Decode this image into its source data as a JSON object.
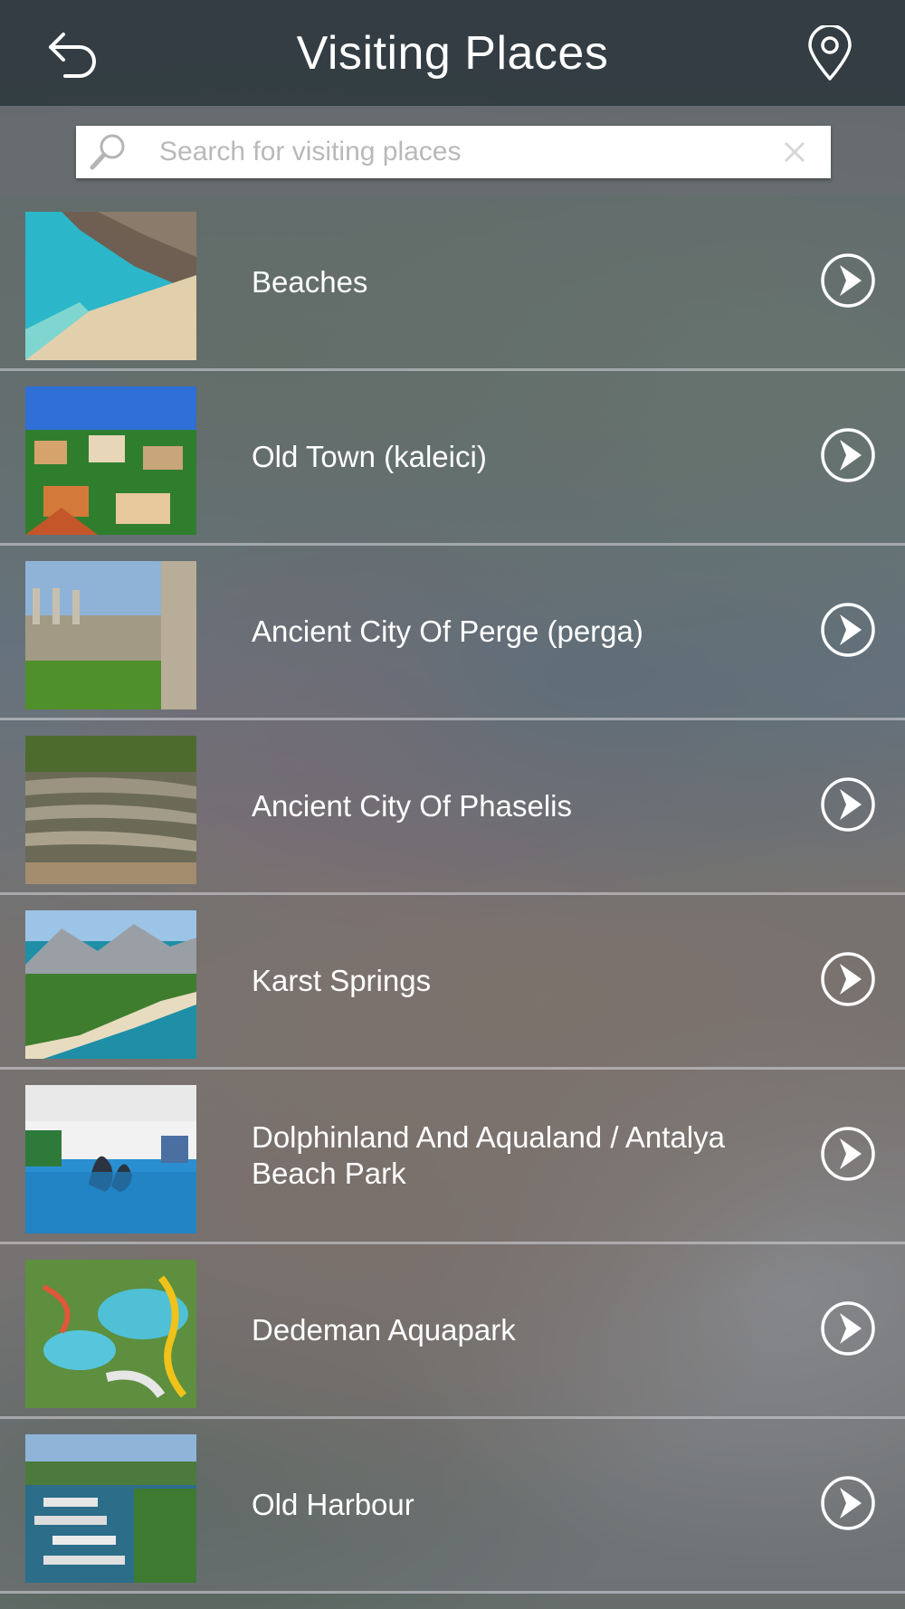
{
  "header": {
    "title": "Visiting Places"
  },
  "search": {
    "placeholder": "Search for visiting places"
  },
  "places": [
    {
      "name": "Beaches",
      "thumb": "beach"
    },
    {
      "name": "Old Town (kaleici)",
      "thumb": "town"
    },
    {
      "name": "Ancient City Of Perge (perga)",
      "thumb": "ruins"
    },
    {
      "name": "Ancient City Of Phaselis",
      "thumb": "amphitheatre"
    },
    {
      "name": "Karst Springs",
      "thumb": "coast"
    },
    {
      "name": "Dolphinland And Aqualand / Antalya Beach Park",
      "thumb": "dolphin"
    },
    {
      "name": "Dedeman Aquapark",
      "thumb": "aquapark"
    },
    {
      "name": "Old Harbour",
      "thumb": "harbour"
    }
  ],
  "colors": {
    "topbar": "#2d373e",
    "text": "#ffffff",
    "separator": "#d7d7dc"
  }
}
